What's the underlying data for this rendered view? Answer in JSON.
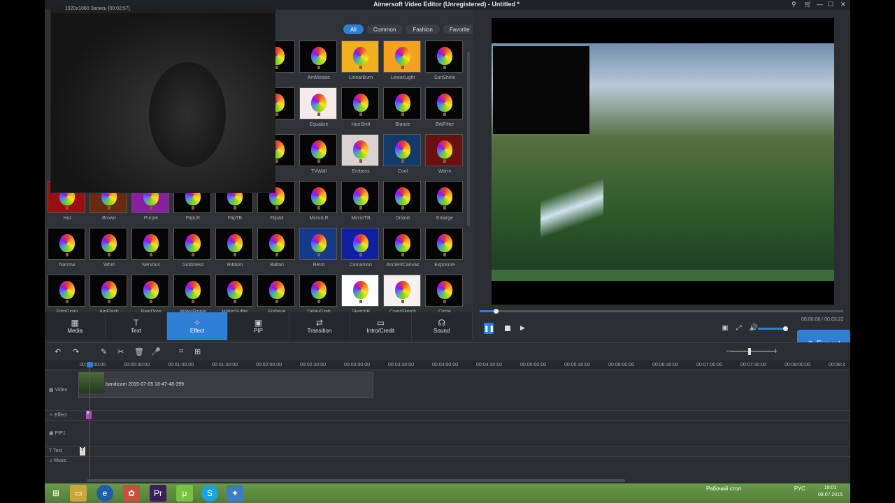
{
  "window": {
    "title": "Aimersoft Video Editor (Unregistered) - Untitled *"
  },
  "recorder": {
    "info": "1920x1080   Запись [00:02:57]"
  },
  "filters": [
    "All",
    "Common",
    "Fashion",
    "Favorite"
  ],
  "effects": [
    [
      "",
      "AmMosaic",
      "LinearBurn",
      "LinearLight",
      "SunShine"
    ],
    [
      "",
      "Equalize",
      "HueShift",
      "Blance",
      "BWFilter"
    ],
    [
      "",
      "TVWall",
      "Emboss",
      "Cool",
      "Warm"
    ],
    [
      "Hot",
      "Brown",
      "Purple",
      "FlipLR",
      "FlipTB",
      "FlipAll",
      "MirrorLR",
      "MirrorTB",
      "Distort",
      "Enlarge"
    ],
    [
      "Narrow",
      "Whirl",
      "Nervous",
      "Giddiness",
      "Ribbon",
      "Baltan",
      "Retro",
      "Cinnamon",
      "AncientCanvas",
      "Exposure"
    ],
    [
      "FilmGrain",
      "AmFlash",
      "RainDrop",
      "WaterRipple",
      "WaterSuffer",
      "Fisheye",
      "DelayGrab",
      "SketchB",
      "ColorSketch",
      "Circle"
    ]
  ],
  "tabs": [
    {
      "label": "Media"
    },
    {
      "label": "Text"
    },
    {
      "label": "Effect"
    },
    {
      "label": "PIP"
    },
    {
      "label": "Transition"
    },
    {
      "label": "Intro/Credit"
    },
    {
      "label": "Sound"
    }
  ],
  "player": {
    "timecode": "00:00:08 / 00:03:22",
    "progress": 0.04,
    "volume": 0.9
  },
  "export_label": "Export",
  "ruler": [
    "00:00:00:00",
    "00:00:30:00",
    "00:01:00:00",
    "00:01:30:00",
    "00:02:00:00",
    "00:02:30:00",
    "00:03:00:00",
    "00:03:30:00",
    "00:04:00:00",
    "00:04:30:00",
    "00:05:00:00",
    "00:05:30:00",
    "00:06:00:00",
    "00:06:30:00",
    "00:07:00:00",
    "00:07:30:00",
    "00:08:00:00",
    "00:08:3"
  ],
  "tracks": {
    "video": "Video",
    "effect": "Effect",
    "pip": "PIP1",
    "text": "Text",
    "music": "Music"
  },
  "clip": {
    "name": "bandicam 2015-07-05 18-47-48-399"
  },
  "taskbar": {
    "tray": "Рабочий стол",
    "lang": "РУС",
    "time": "19:01",
    "date": "08.07.2015"
  }
}
